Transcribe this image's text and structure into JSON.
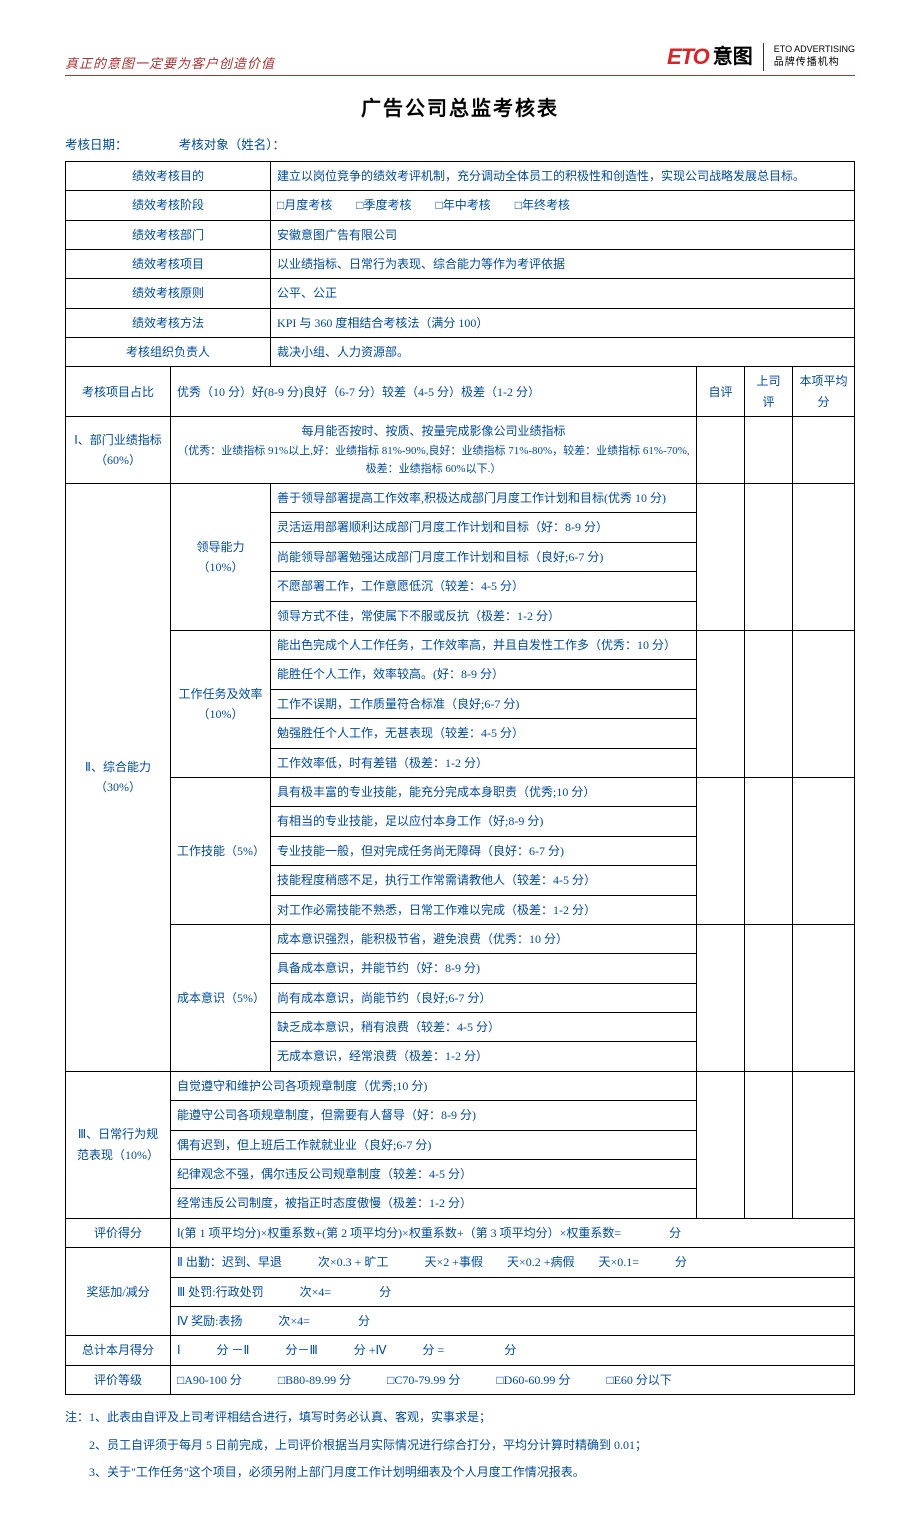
{
  "header": {
    "tagline": "真正的意图一定要为客户创造价值",
    "logo_eto": "ETO",
    "logo_cn": "意图",
    "logo_sub_en": "ETO ADVERTISING",
    "logo_sub_cn": "品牌传播机构"
  },
  "title": "广告公司总监考核表",
  "meta": {
    "date_lbl": "考核日期：",
    "target_lbl": "考核对象（姓名）："
  },
  "rows": {
    "purpose_lbl": "绩效考核目的",
    "purpose_val": "建立以岗位竞争的绩效考评机制，充分调动全体员工的积极性和创造性，实现公司战略发展总目标。",
    "stage_lbl": "绩效考核阶段",
    "stage_val": "□月度考核　　□季度考核　　□年中考核　　□年终考核",
    "dept_lbl": "绩效考核部门",
    "dept_val": "安徽意图广告有限公司",
    "item_lbl": "绩效考核项目",
    "item_val": "以业绩指标、日常行为表现、综合能力等作为考评依据",
    "principle_lbl": "绩效考核原则",
    "principle_val": "公平、公正",
    "method_lbl": "绩效考核方法",
    "method_val": "KPI 与 360 度相结合考核法（满分 100）",
    "owner_lbl": "考核组织负责人",
    "owner_val": "裁决小组、人力资源部。",
    "ratio_lbl": "考核项目占比",
    "ratio_val": "优秀（10 分）好(8-9 分)良好（6-7 分）较差（4-5 分）极差（1-2 分）",
    "self": "自评",
    "boss": "上司评",
    "avg": "本项平均分"
  },
  "sec1": {
    "lbl": "Ⅰ、部门业绩指标（60%）",
    "hdr1": "每月能否按时、按质、按量完成影像公司业绩指标",
    "hdr2": "（优秀：业绩指标 91%以上,好：业绩指标 81%-90%,良好：业绩指标 71%-80%，较差：业绩指标 61%-70%,极差：业绩指标 60%以下.）"
  },
  "sec2": {
    "lbl": "Ⅱ、综合能力（30%）",
    "g1_lbl": "领导能力（10%）",
    "g1": [
      "善于领导部署提高工作效率,积极达成部门月度工作计划和目标(优秀 10 分)",
      "灵活运用部署顺利达成部门月度工作计划和目标（好：8-9 分）",
      "尚能领导部署勉强达成部门月度工作计划和目标（良好;6-7 分)",
      "不愿部署工作，工作意愿低沉（较差：4-5 分）",
      "领导方式不佳，常使属下不服或反抗（极差：1-2 分）"
    ],
    "g2_lbl": "工作任务及效率（10%）",
    "g2": [
      "能出色完成个人工作任务，工作效率高，并且自发性工作多（优秀：10 分）",
      "能胜任个人工作，效率较高。(好：8-9 分）",
      "工作不误期，工作质量符合标准（良好;6-7 分)",
      "勉强胜任个人工作，无甚表现（较差：4-5 分）",
      "工作效率低，时有差错（极差：1-2 分）"
    ],
    "g3_lbl": "工作技能（5%）",
    "g3": [
      "具有极丰富的专业技能，能充分完成本身职责（优秀;10 分）",
      "有相当的专业技能，足以应付本身工作（好;8-9 分)",
      "专业技能一般，但对完成任务尚无障碍（良好：6-7 分)",
      "技能程度稍感不足，执行工作常需请教他人（较差：4-5 分）",
      "对工作必需技能不熟悉，日常工作难以完成（极差：1-2 分）"
    ],
    "g4_lbl": "成本意识（5%）",
    "g4": [
      "成本意识强烈，能积极节省，避免浪费（优秀：10 分）",
      "具备成本意识，并能节约（好：8-9 分)",
      "尚有成本意识，尚能节约（良好;6-7 分）",
      "缺乏成本意识，稍有浪费（较差：4-5 分）",
      "无成本意识，经常浪费（极差：1-2 分）"
    ]
  },
  "sec3": {
    "lbl": "Ⅲ、日常行为规范表现（10%）",
    "rows": [
      "自觉遵守和维护公司各项规章制度（优秀;10 分)",
      "能遵守公司各项规章制度，但需要有人督导（好：8-9 分)",
      "偶有迟到，但上班后工作就就业业（良好;6-7 分)",
      "纪律观念不强，偶尔违反公司规章制度（较差：4-5 分）",
      "经常违反公司制度，被指正时态度傲慢（极差：1-2 分）"
    ]
  },
  "score": {
    "lbl": "评价得分",
    "val": "Ⅰ(第 1 项平均分)×权重系数+(第 2 项平均分)×权重系数+（第 3 项平均分）×权重系数=　　　　分"
  },
  "bonus": {
    "lbl": "奖惩加/减分",
    "r1": "Ⅱ 出勤：迟到、早退　　　次×0.3 + 旷工　　　天×2 +事假　　天×0.2 +病假　　天×0.1=　　　分",
    "r2": "Ⅲ 处罚:行政处罚　　　次×4=　　　　分",
    "r3": "Ⅳ 奖励:表扬　　　次×4=　　　　分"
  },
  "total": {
    "lbl": "总计本月得分",
    "val": "Ⅰ　　　分 －Ⅱ　　　分－Ⅲ　　　分 +Ⅳ　　　分 =　　　　　分"
  },
  "grade": {
    "lbl": "评价等级",
    "val": "□A90-100 分　　　□B80-89.99 分　　　□C70-79.99 分　　　□D60-60.99 分　　　□E60 分以下"
  },
  "notes": {
    "n1": "注：1、此表由自评及上司考评相结合进行，填写时务必认真、客观，实事求是；",
    "n2": "　　2、员工自评须于每月 5 日前完成，上司评价根据当月实际情况进行综合打分，平均分计算时精确到 0.01；",
    "n3": "　　3、关于\"工作任务\"这个项目，必须另附上部门月度工作计划明细表及个人月度工作情况报表。"
  }
}
